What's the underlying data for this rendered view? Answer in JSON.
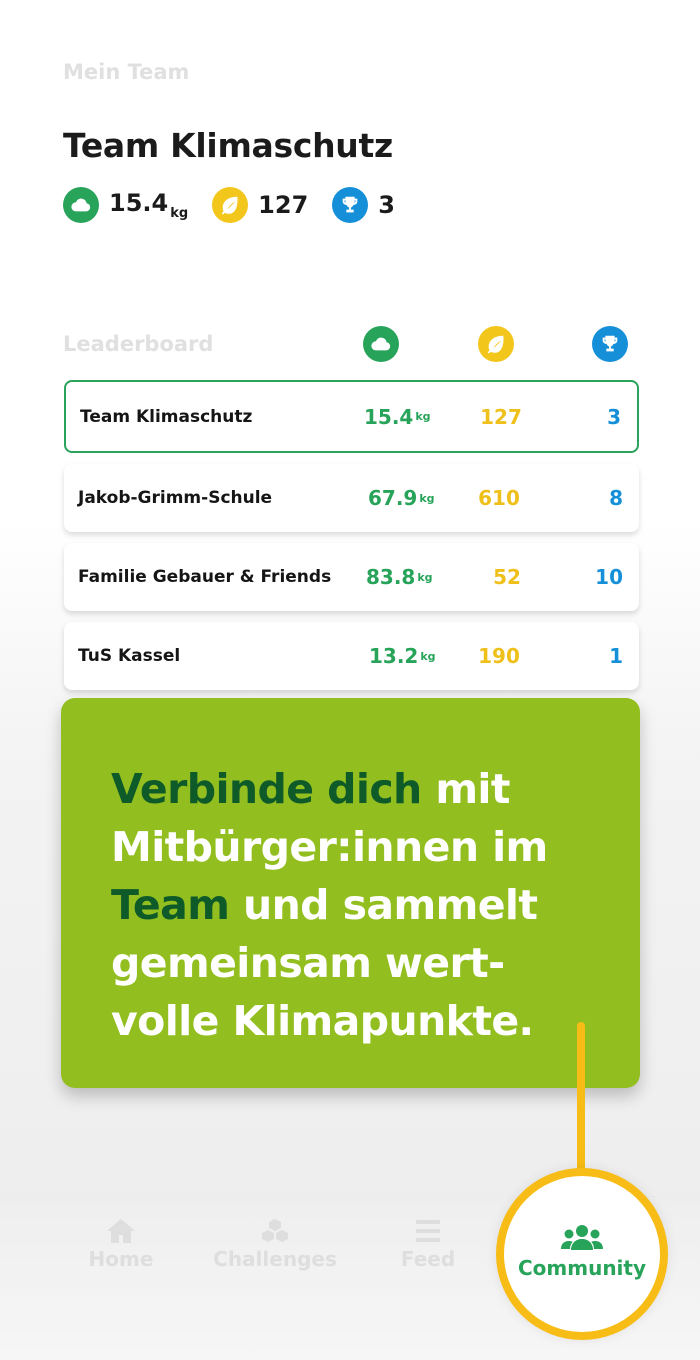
{
  "header": {
    "section_label": "Mein Team",
    "team_name": "Team Klimaschutz",
    "stats": {
      "co2": "15.4",
      "co2_unit": "kg",
      "leaves": "127",
      "trophies": "3"
    }
  },
  "leaderboard": {
    "label": "Leaderboard",
    "rows": [
      {
        "name": "Team Klimaschutz",
        "co2": "15.4",
        "unit": "kg",
        "leaves": "127",
        "trophies": "3"
      },
      {
        "name": "Jakob-Grimm-Schule",
        "co2": "67.9",
        "unit": "kg",
        "leaves": "610",
        "trophies": "8"
      },
      {
        "name": "Familie Gebauer & Friends",
        "co2": "83.8",
        "unit": "kg",
        "leaves": "52",
        "trophies": "10"
      },
      {
        "name": "TuS Kassel",
        "co2": "13.2",
        "unit": "kg",
        "leaves": "190",
        "trophies": "1"
      }
    ]
  },
  "promo": {
    "hl1": "Verbinde dich",
    "t1": " mit Mitbürger:innen im ",
    "hl2": "Team",
    "t2": " und sammelt gemeinsam wert-volle Klimapunkte."
  },
  "nav": {
    "home": "Home",
    "challenges": "Challenges",
    "feed": "Feed",
    "community": "Community"
  },
  "colors": {
    "green": "#27a35a",
    "yellow": "#f2c61a",
    "blue": "#1590d8",
    "promo_bg": "#92bf1f",
    "highlight": "#f7bc15"
  }
}
